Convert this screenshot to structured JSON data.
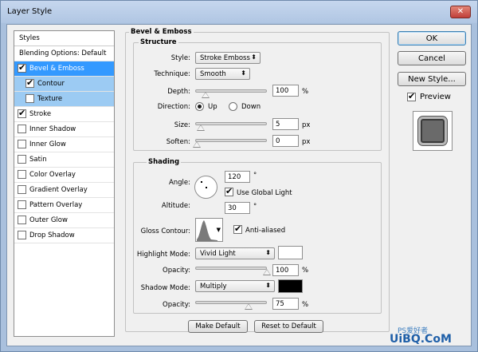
{
  "window": {
    "title": "Layer Style",
    "close_glyph": "✕"
  },
  "style_list": {
    "header": "Styles",
    "blending_options": "Blending Options: Default",
    "items": [
      {
        "label": "Bevel & Emboss",
        "checked": true
      },
      {
        "label": "Contour",
        "checked": true
      },
      {
        "label": "Texture",
        "checked": false
      },
      {
        "label": "Stroke",
        "checked": true
      },
      {
        "label": "Inner Shadow",
        "checked": false
      },
      {
        "label": "Inner Glow",
        "checked": false
      },
      {
        "label": "Satin",
        "checked": false
      },
      {
        "label": "Color Overlay",
        "checked": false
      },
      {
        "label": "Gradient Overlay",
        "checked": false
      },
      {
        "label": "Pattern Overlay",
        "checked": false
      },
      {
        "label": "Outer Glow",
        "checked": false
      },
      {
        "label": "Drop Shadow",
        "checked": false
      }
    ]
  },
  "bevel": {
    "section_title": "Bevel & Emboss",
    "structure": {
      "title": "Structure",
      "style_label": "Style:",
      "style_value": "Stroke Emboss",
      "technique_label": "Technique:",
      "technique_value": "Smooth",
      "depth_label": "Depth:",
      "depth_value": "100",
      "depth_unit": "%",
      "direction_label": "Direction:",
      "direction_up": "Up",
      "direction_down": "Down",
      "size_label": "Size:",
      "size_value": "5",
      "size_unit": "px",
      "soften_label": "Soften:",
      "soften_value": "0",
      "soften_unit": "px"
    },
    "shading": {
      "title": "Shading",
      "angle_label": "Angle:",
      "angle_value": "120",
      "angle_unit": "°",
      "global_light_label": "Use Global Light",
      "altitude_label": "Altitude:",
      "altitude_value": "30",
      "altitude_unit": "°",
      "gloss_label": "Gloss Contour:",
      "anti_aliased_label": "Anti-aliased",
      "highlight_mode_label": "Highlight Mode:",
      "highlight_mode_value": "Vivid Light",
      "highlight_color": "#ffffff",
      "highlight_opacity_label": "Opacity:",
      "highlight_opacity_value": "100",
      "highlight_opacity_unit": "%",
      "shadow_mode_label": "Shadow Mode:",
      "shadow_mode_value": "Multiply",
      "shadow_color": "#000000",
      "shadow_opacity_label": "Opacity:",
      "shadow_opacity_value": "75",
      "shadow_opacity_unit": "%"
    },
    "make_default": "Make Default",
    "reset_default": "Reset to Default"
  },
  "buttons": {
    "ok": "OK",
    "cancel": "Cancel",
    "new_style": "New Style..."
  },
  "preview_label": "Preview",
  "watermark": {
    "text": "UiBQ.CoM",
    "sub": "PS爱好者"
  }
}
